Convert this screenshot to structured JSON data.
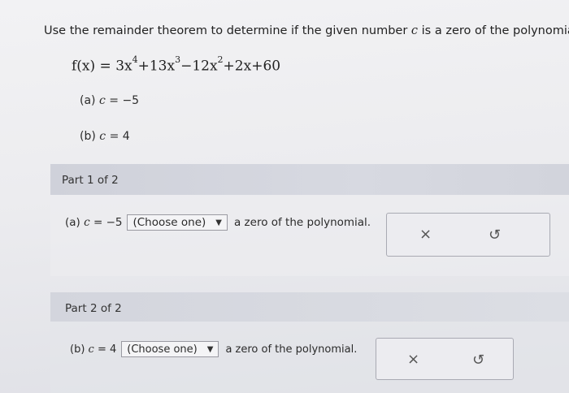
{
  "question": {
    "prefix": "Use the remainder theorem to determine if the given number",
    "var": "c",
    "suffix": "is a zero of the polynomial."
  },
  "formula": {
    "lhs": "f(x) = 3x",
    "e1": "4",
    "t2": "+13x",
    "e2": "3",
    "t3": "−12x",
    "e3": "2",
    "t4": "+2x+60"
  },
  "cases": {
    "a_label": "(a)",
    "a_value": "= −5",
    "b_label": "(b)",
    "b_value": "= 4"
  },
  "part1": {
    "header": "Part 1 of 2",
    "label": "(a)",
    "value": "= −5",
    "select_value": "(Choose one)",
    "suffix": "a zero of the polynomial."
  },
  "part2": {
    "header": "Part 2 of 2",
    "label": "(b)",
    "value": "= 4",
    "select_value": "(Choose one)",
    "suffix": "a zero of the polynomial."
  },
  "icons": {
    "clear": "×",
    "undo": "↺",
    "caret": "▼"
  }
}
